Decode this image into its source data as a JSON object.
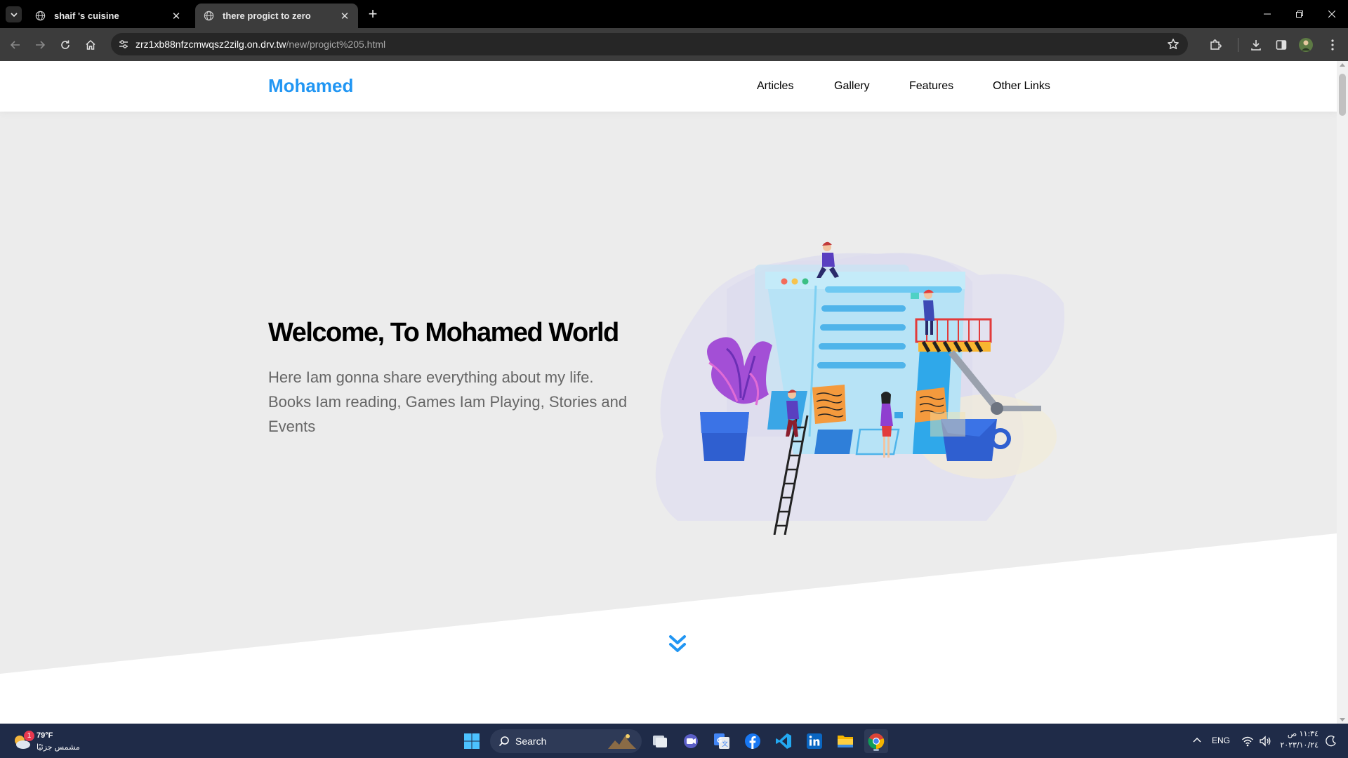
{
  "browser": {
    "tabs": [
      {
        "title": "shaif 's cuisine",
        "active": false
      },
      {
        "title": "there progict to zero",
        "active": true
      }
    ],
    "url_host": "zrz1xb88nfzcmwqsz2zilg.on.drv.tw",
    "url_path": "/new/progict%205.html"
  },
  "site": {
    "logo": "Mohamed",
    "nav": [
      "Articles",
      "Gallery",
      "Features",
      "Other Links"
    ],
    "hero_title": "Welcome, To Mohamed World",
    "hero_text": "Here Iam gonna share everything about my life. Books Iam reading, Games Iam Playing, Stories and Events",
    "accent_color": "#2196f3"
  },
  "taskbar": {
    "weather_temp": "79°F",
    "weather_condition": "مشمس جزئيًا",
    "weather_badge": "1",
    "search_label": "Search",
    "apps": [
      "windows-start",
      "search",
      "task-view",
      "teams",
      "google-translate",
      "facebook",
      "vscode",
      "linkedin",
      "file-explorer",
      "chrome"
    ],
    "language": "ENG",
    "time": "١١:٣٤ ص",
    "date": "٢٠٢٣/١٠/٢٤"
  }
}
